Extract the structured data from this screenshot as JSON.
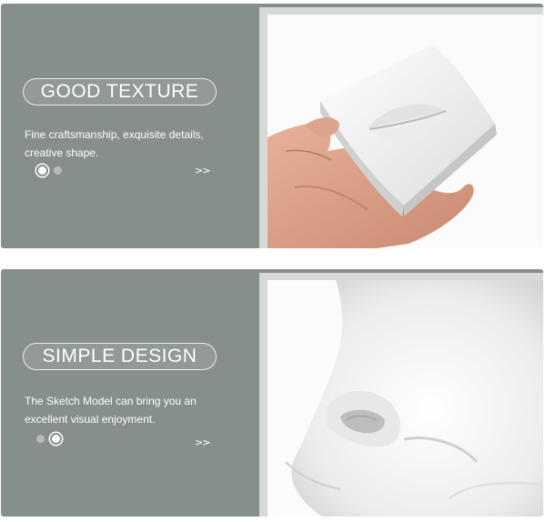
{
  "slides": [
    {
      "title": "GOOD TEXTURE",
      "description": "Fine craftsmanship, exquisite details, creative shape.",
      "active_dot": 0,
      "arrow": ">>",
      "image": "hand-holding-mouth-model"
    },
    {
      "title": "SIMPLE DESIGN",
      "description": "The Sketch Model can bring you an excellent visual enjoyment.",
      "active_dot": 1,
      "arrow": ">>",
      "image": "nose-model-closeup"
    }
  ],
  "colors": {
    "panel_background": "#868f89",
    "frame": "#d6dad7",
    "text": "#ffffff",
    "dot_inactive": "#b7bdb9"
  }
}
